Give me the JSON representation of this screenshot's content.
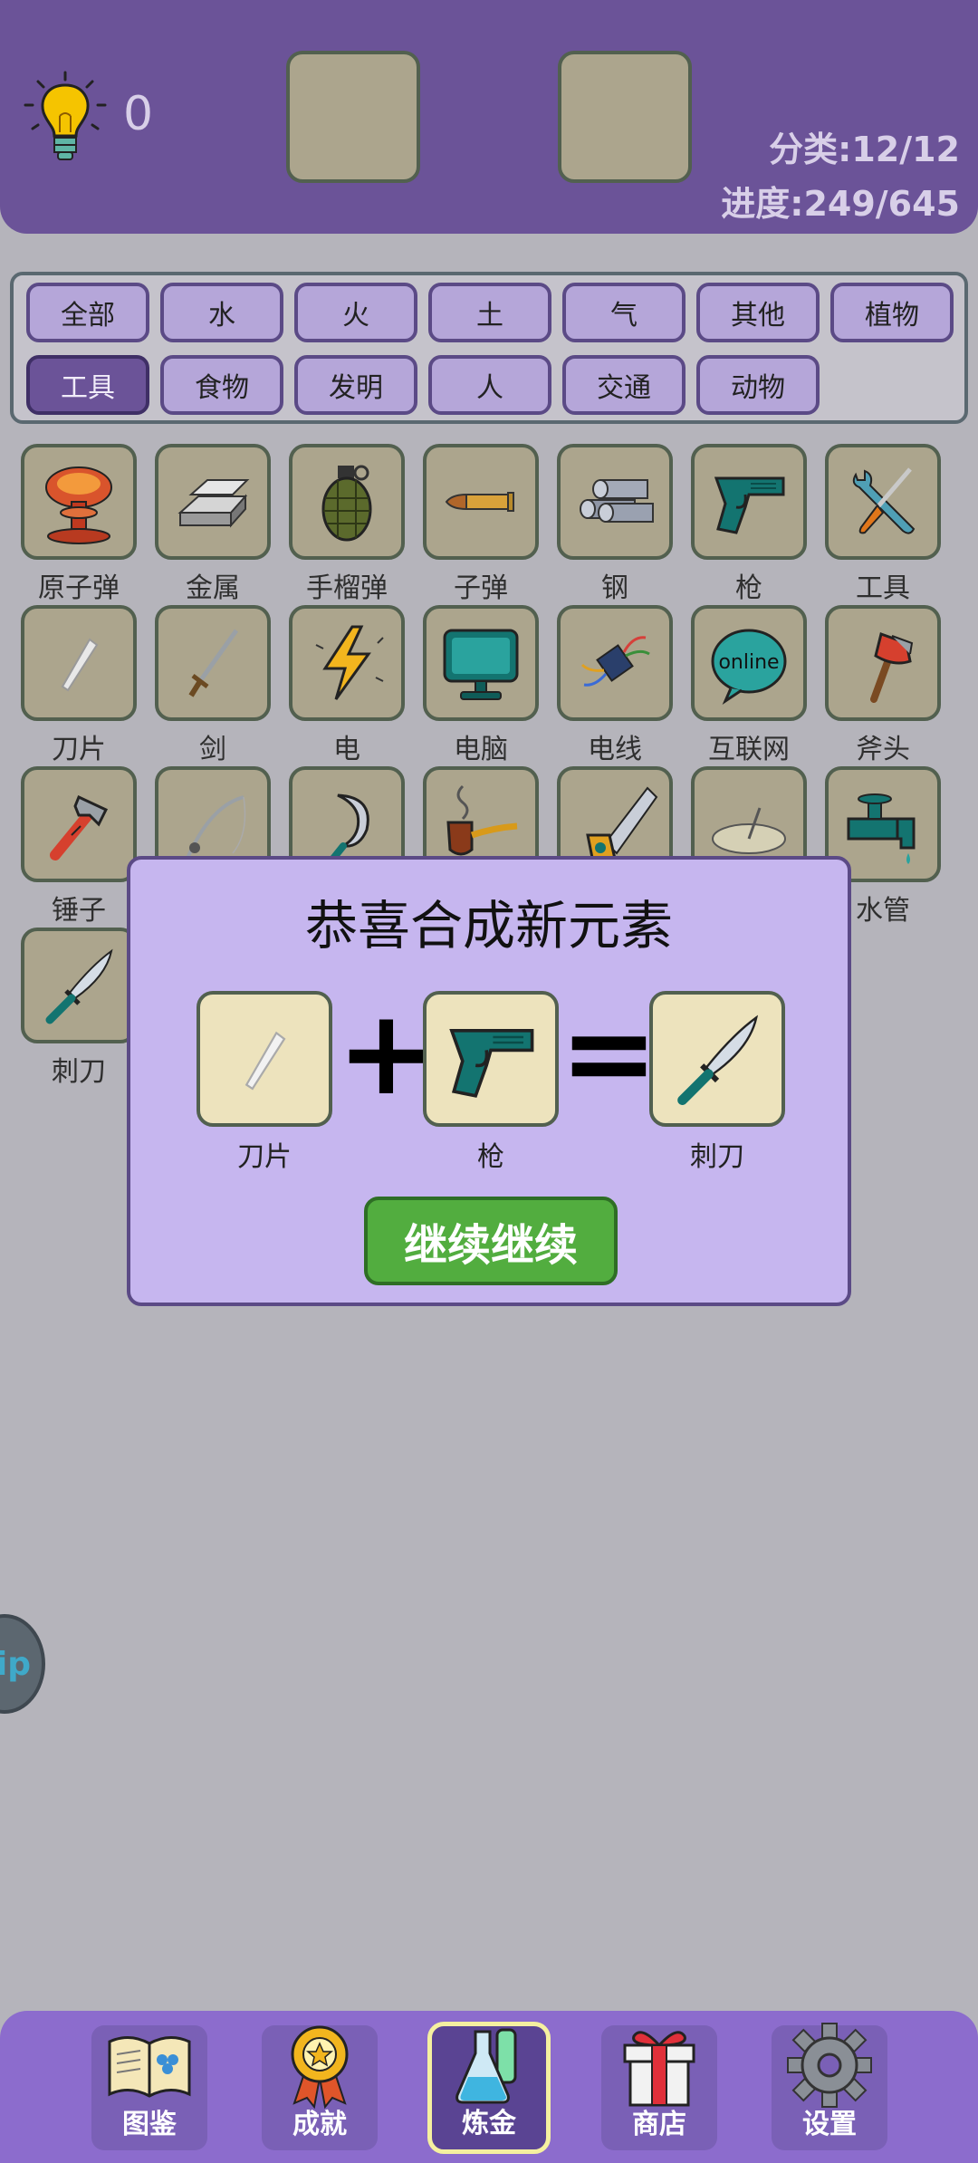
{
  "header": {
    "hint_count": "0",
    "category_stat": "分类:12/12",
    "progress_stat": "进度:249/645"
  },
  "categories": [
    {
      "label": "全部",
      "active": false
    },
    {
      "label": "水",
      "active": false
    },
    {
      "label": "火",
      "active": false
    },
    {
      "label": "土",
      "active": false
    },
    {
      "label": "气",
      "active": false
    },
    {
      "label": "其他",
      "active": false
    },
    {
      "label": "植物",
      "active": false
    },
    {
      "label": "工具",
      "active": true
    },
    {
      "label": "食物",
      "active": false
    },
    {
      "label": "发明",
      "active": false
    },
    {
      "label": "人",
      "active": false
    },
    {
      "label": "交通",
      "active": false
    },
    {
      "label": "动物",
      "active": false
    }
  ],
  "elements": [
    {
      "label": "原子弹",
      "icon": "mushroom-cloud-icon"
    },
    {
      "label": "金属",
      "icon": "metal-ingot-icon"
    },
    {
      "label": "手榴弹",
      "icon": "grenade-icon"
    },
    {
      "label": "子弹",
      "icon": "bullet-icon"
    },
    {
      "label": "钢",
      "icon": "steel-pipes-icon"
    },
    {
      "label": "枪",
      "icon": "pistol-icon"
    },
    {
      "label": "工具",
      "icon": "wrench-screwdriver-icon"
    },
    {
      "label": "刀片",
      "icon": "blade-icon"
    },
    {
      "label": "剑",
      "icon": "sword-icon"
    },
    {
      "label": "电",
      "icon": "lightning-icon"
    },
    {
      "label": "电脑",
      "icon": "computer-monitor-icon"
    },
    {
      "label": "电线",
      "icon": "wires-icon"
    },
    {
      "label": "互联网",
      "icon": "online-bubble-icon"
    },
    {
      "label": "斧头",
      "icon": "axe-icon"
    },
    {
      "label": "锤子",
      "icon": "hammer-icon"
    },
    {
      "label": "",
      "icon": "fishing-rod-icon"
    },
    {
      "label": "",
      "icon": "sickle-icon"
    },
    {
      "label": "",
      "icon": "pipe-icon"
    },
    {
      "label": "",
      "icon": "saw-icon"
    },
    {
      "label": "",
      "icon": "sundial-icon"
    },
    {
      "label": "水管",
      "icon": "faucet-icon"
    },
    {
      "label": "刺刀",
      "icon": "bayonet-icon"
    }
  ],
  "online_text": "online",
  "side_pill_text": "ip",
  "modal": {
    "title": "恭喜合成新元素",
    "input1": "刀片",
    "input2": "枪",
    "result": "刺刀",
    "plus": "+",
    "equals": "=",
    "continue_label": "继续继续"
  },
  "nav": [
    {
      "label": "图鉴",
      "icon": "book-icon"
    },
    {
      "label": "成就",
      "icon": "medal-icon"
    },
    {
      "label": "炼金",
      "icon": "flask-icon",
      "active": true
    },
    {
      "label": "商店",
      "icon": "gift-icon"
    },
    {
      "label": "设置",
      "icon": "gear-icon"
    }
  ],
  "colors": {
    "header_bg": "#6b5398",
    "page_bg": "#b5b4bb",
    "tile_bg": "#aca58d",
    "modal_bg": "#c6b6ef",
    "continue_green": "#52ad3f",
    "nav_bg": "#8c6ccd"
  }
}
